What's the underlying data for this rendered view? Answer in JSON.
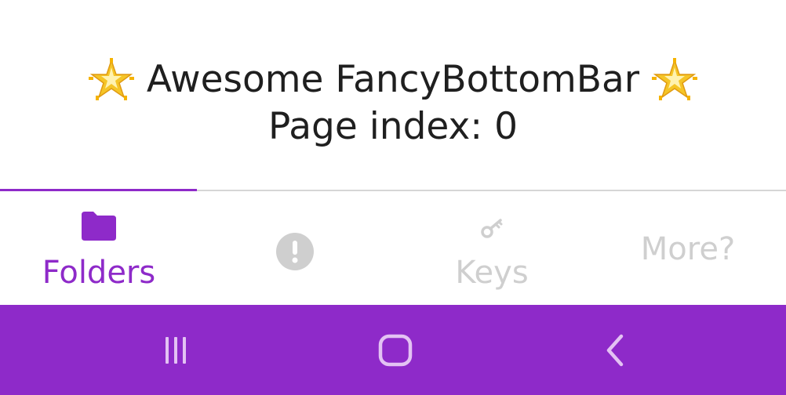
{
  "content": {
    "title_text": "Awesome FancyBottomBar",
    "title_decoration_icon": "sparkle-star-emoji",
    "page_index_text": "Page index: 0"
  },
  "bottom_bar": {
    "accent_color": "#8e2ac9",
    "inactive_color": "#cfcfcf",
    "selected_index": 0,
    "tabs": [
      {
        "label": "Folders",
        "icon": "folder-icon",
        "selected": true
      },
      {
        "label": "",
        "icon": "alert-circle-icon",
        "selected": false
      },
      {
        "label": "Keys",
        "icon": "key-icon",
        "selected": false
      },
      {
        "label": "More?",
        "icon": "",
        "selected": false
      }
    ]
  },
  "system_nav": {
    "background_color": "#8e2ac9",
    "buttons": [
      {
        "name": "recents",
        "icon": "recents-icon"
      },
      {
        "name": "home",
        "icon": "home-icon"
      },
      {
        "name": "back",
        "icon": "back-icon"
      }
    ]
  }
}
